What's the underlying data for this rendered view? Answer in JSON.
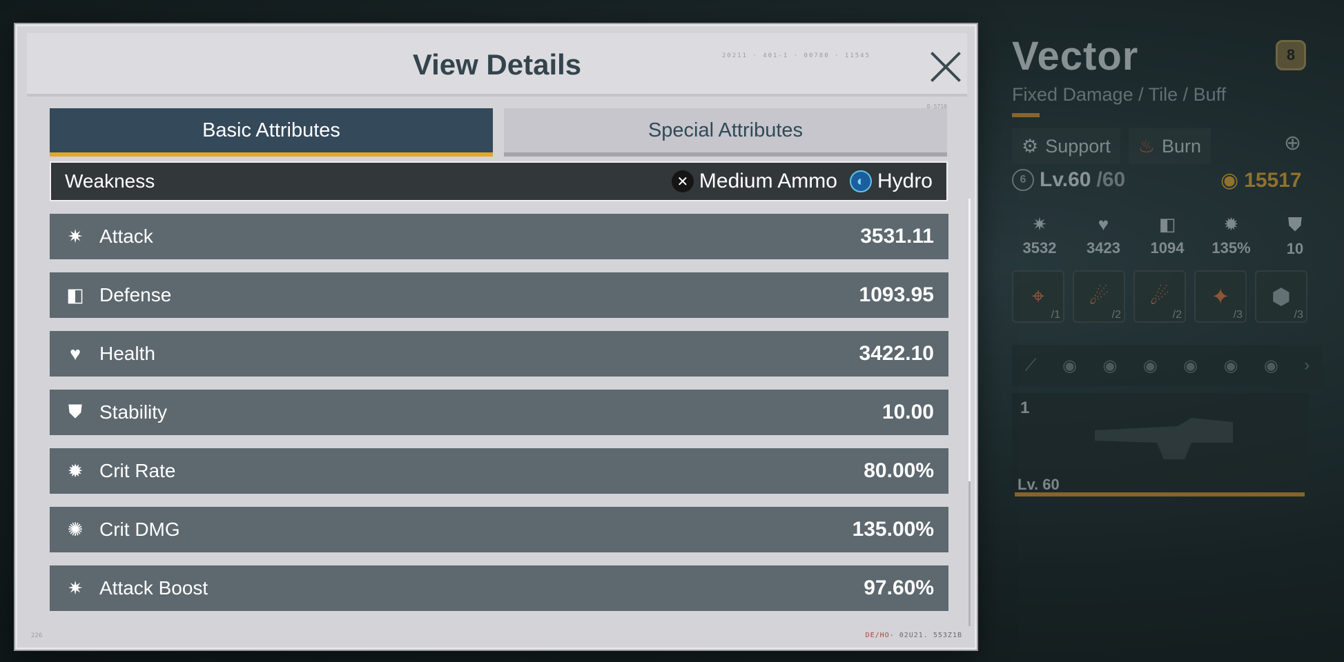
{
  "background_panel": {
    "name": "Vector",
    "rank": "8",
    "subtitle": "Fixed Damage / Tile / Buff",
    "tags": [
      "Support",
      "Burn"
    ],
    "level_prefix": "Lv.60",
    "level_max": "/60",
    "level_badge": "6",
    "power": "15517",
    "stats": [
      "3532",
      "3423",
      "1094",
      "135%",
      "10"
    ],
    "skills": [
      "/1",
      "/2",
      "/2",
      "/3",
      "/3"
    ],
    "weapon_index": "1",
    "weapon_level": "Lv. 60"
  },
  "modal": {
    "title": "View Details",
    "header_code": "20211 · 401-1 · 00780 · 11545",
    "side_code": "D-5710",
    "footer_left": "226",
    "footer_right_red": "DE/HO-",
    "footer_right": "02U21. 553Z1B"
  },
  "tabs": {
    "basic": "Basic Attributes",
    "special": "Special Attributes"
  },
  "weakness": {
    "label": "Weakness",
    "items": [
      {
        "name": "Medium Ammo",
        "icon": "crossed-swords-icon"
      },
      {
        "name": "Hydro",
        "icon": "hydro-icon"
      }
    ]
  },
  "attributes": [
    {
      "label": "Attack",
      "value": "3531.11",
      "icon": "attack-icon"
    },
    {
      "label": "Defense",
      "value": "1093.95",
      "icon": "defense-icon"
    },
    {
      "label": "Health",
      "value": "3422.10",
      "icon": "health-icon"
    },
    {
      "label": "Stability",
      "value": "10.00",
      "icon": "stability-icon"
    },
    {
      "label": "Crit Rate",
      "value": "80.00%",
      "icon": "crit-rate-icon"
    },
    {
      "label": "Crit DMG",
      "value": "135.00%",
      "icon": "crit-dmg-icon"
    },
    {
      "label": "Attack Boost",
      "value": "97.60%",
      "icon": "attack-boost-icon"
    }
  ],
  "colors": {
    "accent": "#e2a72b",
    "tab_active": "#34495a",
    "row_bg": "#5d686f",
    "weakness_bg": "#323739"
  }
}
